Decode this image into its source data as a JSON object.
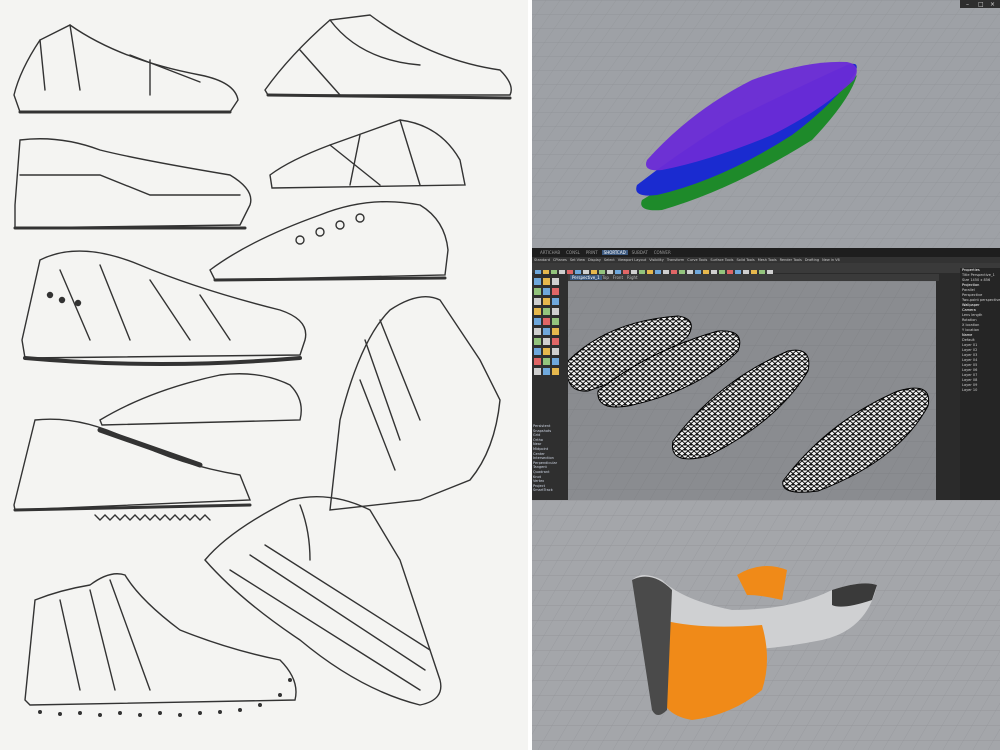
{
  "rhino": {
    "tabs": [
      "ARTICHAB",
      "CONSL",
      "PRINT",
      "SHORTCAD",
      "SUBDAT",
      "CONVER"
    ],
    "menu": [
      "Standard",
      "CPlanes",
      "Set View",
      "Display",
      "Select",
      "Viewport Layout",
      "Visibility",
      "Transform",
      "Curve Tools",
      "Surface Tools",
      "Solid Tools",
      "Mesh Tools",
      "Render Tools",
      "Drafting",
      "New in V6"
    ],
    "viewport_tabs": [
      "Perspective",
      "Top",
      "Front",
      "Right"
    ],
    "active_viewport": "Perspective_1",
    "layers": [
      "Persistent",
      "Snapshots",
      "Grid",
      "Ortho",
      "Near",
      "Midpoint",
      "Center",
      "Intersection",
      "Perpendicular",
      "Tangent",
      "Quadrant",
      "Knot",
      "Vertex",
      "Project",
      "SmartTrack"
    ],
    "properties": {
      "title_label": "Properties",
      "title": "Title",
      "title_value": "Perspective_1",
      "size_label": "Size",
      "size_value": "1450 x 856",
      "projection_label": "Projection",
      "projection_options": [
        "Parallel",
        "Perspective",
        "Two-point perspective"
      ],
      "wallpaper_label": "Wallpaper",
      "camera_label": "Camera",
      "lens_label": "Lens length",
      "rotation_label": "Rotation",
      "x_label": "X location",
      "y_label": "Y location",
      "layers_header": "Name",
      "layer_items": [
        "Default",
        "Layer 01",
        "Layer 02",
        "Layer 03",
        "Layer 04",
        "Layer 05",
        "Layer 06",
        "Layer 07",
        "Layer 08",
        "Layer 09",
        "Layer 10"
      ]
    }
  },
  "colors": {
    "insole_top": "#6a2bd6",
    "insole_mid": "#1a2bd0",
    "insole_bottom": "#1e8a2a",
    "shoe_orange": "#f08a18",
    "shoe_gray": "#c8c8c8"
  }
}
